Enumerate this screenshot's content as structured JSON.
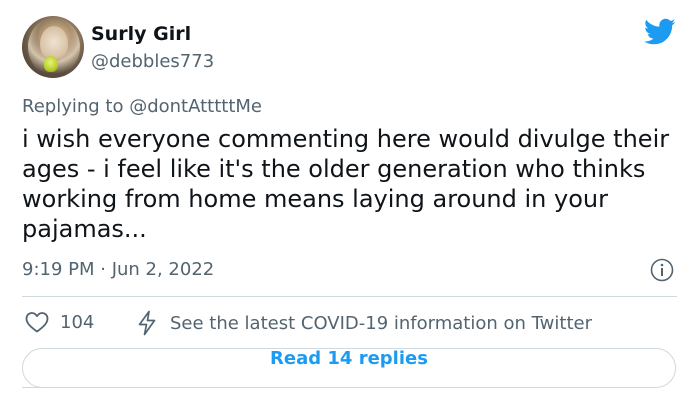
{
  "tweet": {
    "author": {
      "display_name": "Surly Girl",
      "handle": "@debbles773"
    },
    "reply_prefix": "Replying to ",
    "reply_to": "@dontAtttttMe",
    "text": "i wish everyone commenting here would divulge their ages - i feel like it's the older generation who thinks working from home means laying around in your pajamas...",
    "timestamp": "9:19 PM · Jun 2, 2022",
    "likes": "104",
    "covid_link": "See the latest COVID-19 information on Twitter",
    "read_more": "Read 14 replies"
  },
  "icons": {
    "brand": "twitter-bird-icon",
    "info": "info-icon",
    "like": "heart-icon",
    "covid": "lightning-bolt-icon"
  },
  "colors": {
    "accent": "#1d9bf0",
    "text_primary": "#0f1419",
    "text_secondary": "#536471",
    "divider": "#cfd9de"
  }
}
